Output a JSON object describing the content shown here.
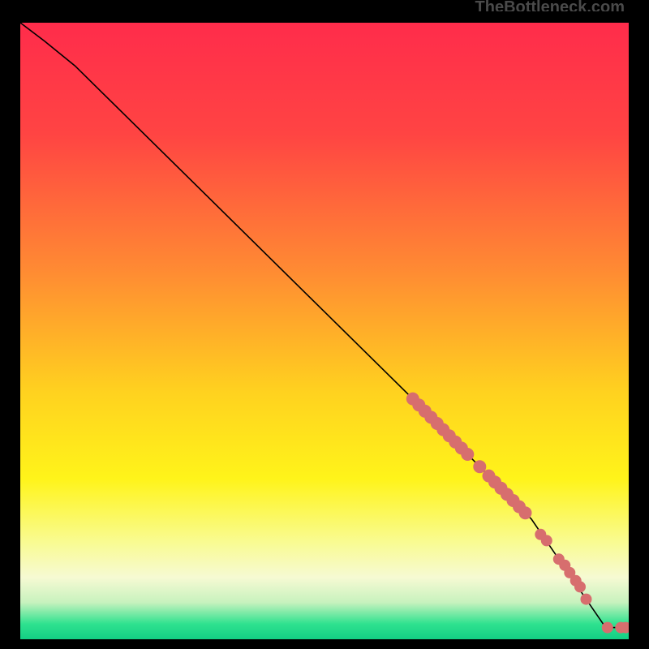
{
  "watermark": "TheBottleneck.com",
  "chart_data": {
    "type": "line",
    "title": "",
    "xlabel": "",
    "ylabel": "",
    "xlim": [
      0,
      100
    ],
    "ylim": [
      0,
      100
    ],
    "background_gradient": {
      "stops": [
        {
          "pos": 0.0,
          "color": "#FF2C4B"
        },
        {
          "pos": 0.18,
          "color": "#FF4443"
        },
        {
          "pos": 0.4,
          "color": "#FF8A33"
        },
        {
          "pos": 0.6,
          "color": "#FFD21F"
        },
        {
          "pos": 0.74,
          "color": "#FFF41A"
        },
        {
          "pos": 0.84,
          "color": "#F9FB8F"
        },
        {
          "pos": 0.9,
          "color": "#F6FAD3"
        },
        {
          "pos": 0.94,
          "color": "#C8F2BE"
        },
        {
          "pos": 0.975,
          "color": "#2FE28F"
        },
        {
          "pos": 1.0,
          "color": "#13CF84"
        }
      ]
    },
    "curve": [
      {
        "x": 0,
        "y": 100
      },
      {
        "x": 4,
        "y": 97
      },
      {
        "x": 9,
        "y": 93
      },
      {
        "x": 64.5,
        "y": 39
      },
      {
        "x": 83,
        "y": 20.5
      },
      {
        "x": 84,
        "y": 19.5
      },
      {
        "x": 93,
        "y": 6.5
      },
      {
        "x": 96,
        "y": 2.2
      },
      {
        "x": 96.5,
        "y": 1.9
      },
      {
        "x": 98.7,
        "y": 1.9
      },
      {
        "x": 99.5,
        "y": 1.9
      }
    ],
    "markers_stacked": [
      {
        "x": 64.5,
        "y": 39.0
      },
      {
        "x": 65.5,
        "y": 38.0
      },
      {
        "x": 66.5,
        "y": 37.0
      },
      {
        "x": 67.5,
        "y": 36.0
      },
      {
        "x": 68.5,
        "y": 35.0
      },
      {
        "x": 69.5,
        "y": 34.0
      },
      {
        "x": 70.5,
        "y": 33.0
      },
      {
        "x": 71.5,
        "y": 32.0
      },
      {
        "x": 72.5,
        "y": 31.0
      },
      {
        "x": 73.5,
        "y": 30.0
      },
      {
        "x": 75.5,
        "y": 28.0
      },
      {
        "x": 77.0,
        "y": 26.5
      },
      {
        "x": 78.0,
        "y": 25.5
      },
      {
        "x": 79.0,
        "y": 24.5
      },
      {
        "x": 80.0,
        "y": 23.5
      },
      {
        "x": 81.0,
        "y": 22.5
      },
      {
        "x": 82.0,
        "y": 21.5
      },
      {
        "x": 83.0,
        "y": 20.5
      }
    ],
    "markers_single": [
      {
        "x": 85.5,
        "y": 17.0
      },
      {
        "x": 86.5,
        "y": 16.0
      },
      {
        "x": 88.5,
        "y": 13.0
      },
      {
        "x": 89.5,
        "y": 12.0
      },
      {
        "x": 90.3,
        "y": 10.8
      },
      {
        "x": 91.3,
        "y": 9.5
      },
      {
        "x": 92.0,
        "y": 8.5
      },
      {
        "x": 93.0,
        "y": 6.5
      },
      {
        "x": 96.5,
        "y": 1.9
      },
      {
        "x": 98.7,
        "y": 1.9
      },
      {
        "x": 99.5,
        "y": 1.9
      }
    ]
  }
}
